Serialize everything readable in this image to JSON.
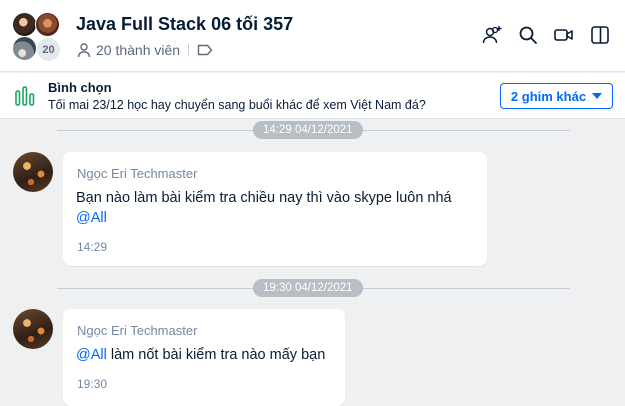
{
  "header": {
    "title": "Java Full Stack 06 tối 357",
    "member_badge": "20",
    "member_text": "20 thành viên",
    "icons": [
      "add-member-icon",
      "search-icon",
      "video-call-icon",
      "sidebar-toggle-icon"
    ]
  },
  "poll": {
    "title": "Bình chọn",
    "text": "Tối mai 23/12 học hay chuyển sang buổi khác để xem Việt Nam đá?",
    "pin_button": "2 ghim khác"
  },
  "messages": [
    {
      "date": "14:29 04/12/2021",
      "sender": "Ngọc Eri Techmaster",
      "line1": "Bạn nào làm bài kiểm tra chiều nay thì vào skype luôn nhá",
      "mention": "@All",
      "time": "14:29"
    },
    {
      "date": "19:30 04/12/2021",
      "sender": "Ngọc Eri Techmaster",
      "mention": "@All",
      "line1": " làm nốt bài kiểm tra nào mấy bạn",
      "time": "19:30"
    }
  ],
  "colors": {
    "accent": "#0068ff",
    "poll_icon": "#1fa463",
    "background": "#eef0f1"
  }
}
